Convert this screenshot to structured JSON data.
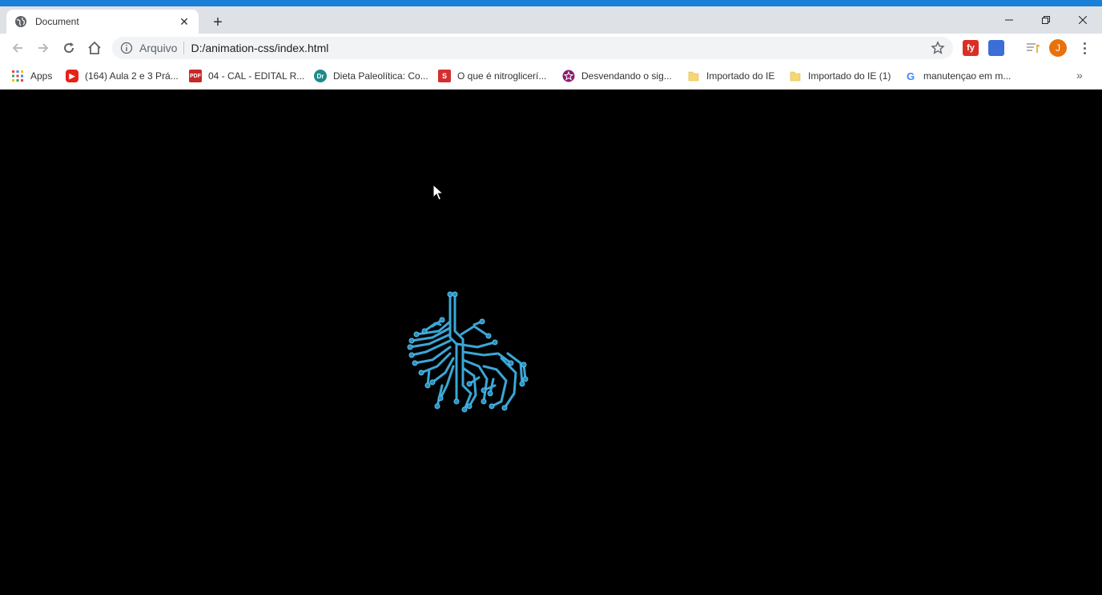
{
  "browser": {
    "tab_title": "Document",
    "new_tab_symbol": "+",
    "close_symbol": "✕",
    "address": {
      "scheme_label": "Arquivo",
      "url": "D:/animation-css/index.html"
    },
    "avatar_initial": "J",
    "extensions": [
      {
        "label": "fy",
        "color": "#d93025"
      },
      {
        "label": "",
        "color": "#3b6fd6"
      }
    ]
  },
  "bookmarks": [
    {
      "label": "Apps",
      "icon": "apps-grid-icon"
    },
    {
      "label": "(164) Aula 2 e 3 Prá...",
      "icon": "youtube-icon"
    },
    {
      "label": "04 - CAL - EDITAL R...",
      "icon": "pdf-icon"
    },
    {
      "label": "Dieta Paleolítica: Co...",
      "icon": "dr-icon"
    },
    {
      "label": "O que é nitroglicerí...",
      "icon": "s-icon"
    },
    {
      "label": "Desvendando o sig...",
      "icon": "star-badge-icon"
    },
    {
      "label": "Importado do IE",
      "icon": "folder-icon"
    },
    {
      "label": "Importado do IE (1)",
      "icon": "folder-icon"
    },
    {
      "label": "manutençao em m...",
      "icon": "google-icon"
    }
  ],
  "bookmarks_more": "»",
  "page": {
    "background": "#000000",
    "graphic": "circuit-brain-icon",
    "graphic_color": "#3aa7d6"
  }
}
